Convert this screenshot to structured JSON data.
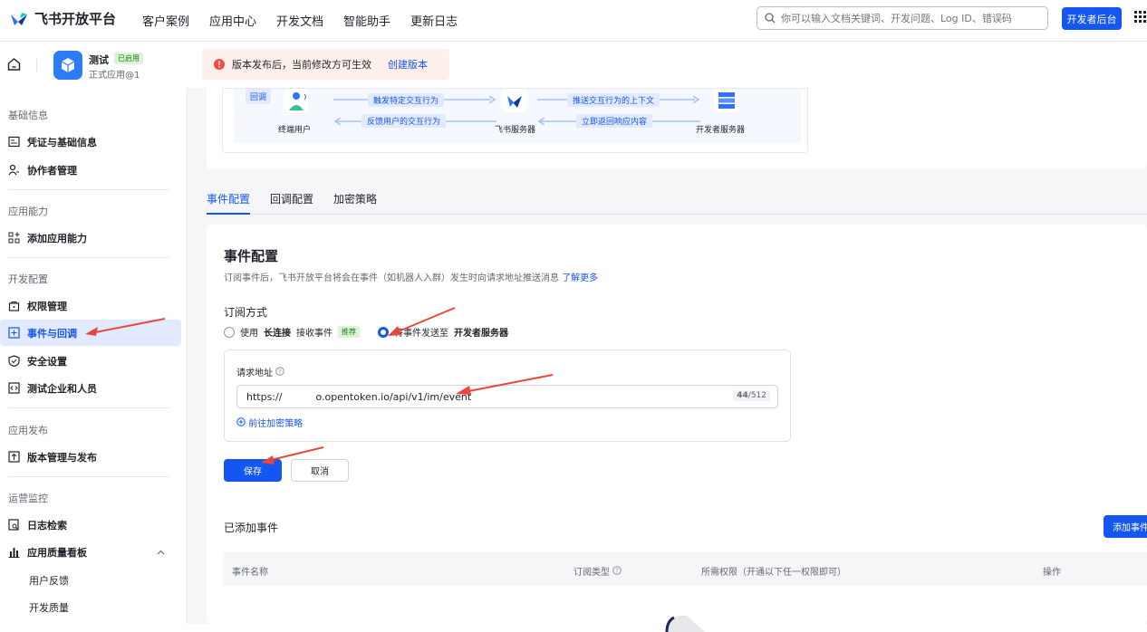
{
  "topbar": {
    "logo_text": "飞书开放平台",
    "nav": [
      "客户案例",
      "应用中心",
      "开发文档",
      "智能助手",
      "更新日志"
    ],
    "search_placeholder": "你可以输入文档关键词、开发问题、Log ID、错误码",
    "dev_console": "开发者后台"
  },
  "app": {
    "name": "测试",
    "badge": "已启用",
    "sub": "正式应用@1"
  },
  "notice": {
    "text": "版本发布后，当前修改方可生效",
    "link": "创建版本"
  },
  "sidebar": {
    "groups": [
      "基础信息",
      "应用能力",
      "开发配置",
      "应用发布",
      "运营监控"
    ],
    "items": [
      {
        "label": "凭证与基础信息"
      },
      {
        "label": "协作者管理"
      },
      {
        "label": "添加应用能力"
      },
      {
        "label": "权限管理"
      },
      {
        "label": "事件与回调"
      },
      {
        "label": "安全设置"
      },
      {
        "label": "测试企业和人员"
      },
      {
        "label": "版本管理与发布"
      },
      {
        "label": "日志检索"
      },
      {
        "label": "应用质量看板"
      },
      {
        "label": "用户反馈"
      },
      {
        "label": "开发质量"
      }
    ]
  },
  "diagram": {
    "tag": "回调",
    "end_user": "终端用户",
    "feishu_server": "飞书服务器",
    "dev_server": "开发者服务器",
    "arrow1": "触发特定交互行为",
    "arrow2": "反馈用户的交互行为",
    "arrow3": "推送交互行为的上下文",
    "arrow4": "立即返回响应内容"
  },
  "tabs": [
    "事件配置",
    "回调配置",
    "加密策略"
  ],
  "event_config": {
    "title": "事件配置",
    "desc": "订阅事件后，飞书开放平台将会在事件（如机器人入群）发生时向请求地址推送消息",
    "desc_link": "了解更多",
    "sub_title": "订阅方式",
    "opt1_pre": "使用",
    "opt1_bold": "长连接",
    "opt1_post": "接收事件",
    "opt1_tag": "推荐",
    "opt2_pre": "将事件发送至",
    "opt2_bold": "开发者服务器",
    "url_label": "请求地址",
    "url_prefix": "https://",
    "url_rest": "o.opentoken.io/api/v1/im/event",
    "url_count": "44",
    "url_count_max": "/512",
    "encrypt_link": "前往加密策略",
    "save": "保存",
    "cancel": "取消"
  },
  "added_events": {
    "title": "已添加事件",
    "add_button": "添加事件",
    "columns": [
      "事件名称",
      "订阅类型",
      "所需权限（开通以下任一权限即可）",
      "操作"
    ]
  },
  "colors": {
    "accent": "#1456f0",
    "annotation": "#e8473c"
  }
}
